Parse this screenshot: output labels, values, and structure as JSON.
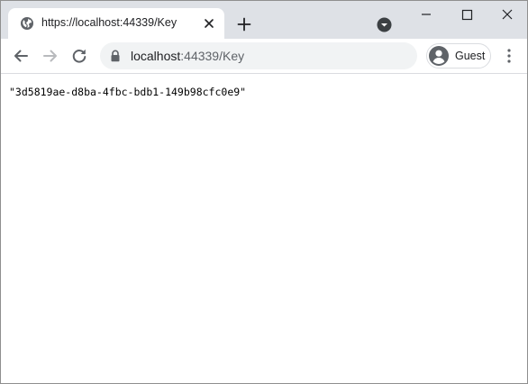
{
  "tab": {
    "title": "https://localhost:44339/Key",
    "favicon": "globe-icon"
  },
  "toolbar": {
    "url_host": "localhost",
    "url_rest": ":44339/Key",
    "profile_label": "Guest"
  },
  "page": {
    "response_text": "\"3d5819ae-d8ba-4fbc-bdb1-149b98cfc0e9\""
  },
  "icons": {
    "back": "arrow-left-icon",
    "forward": "arrow-right-icon",
    "reload": "reload-icon",
    "lock": "lock-icon",
    "menu": "kebab-menu-icon",
    "new_tab": "plus-icon",
    "tab_search": "chevron-down-circle-icon"
  },
  "colors": {
    "tabstrip": "#dee1e6",
    "omnibox": "#f1f3f4",
    "icon": "#5f6368",
    "forward_disabled": "#b8babd"
  }
}
